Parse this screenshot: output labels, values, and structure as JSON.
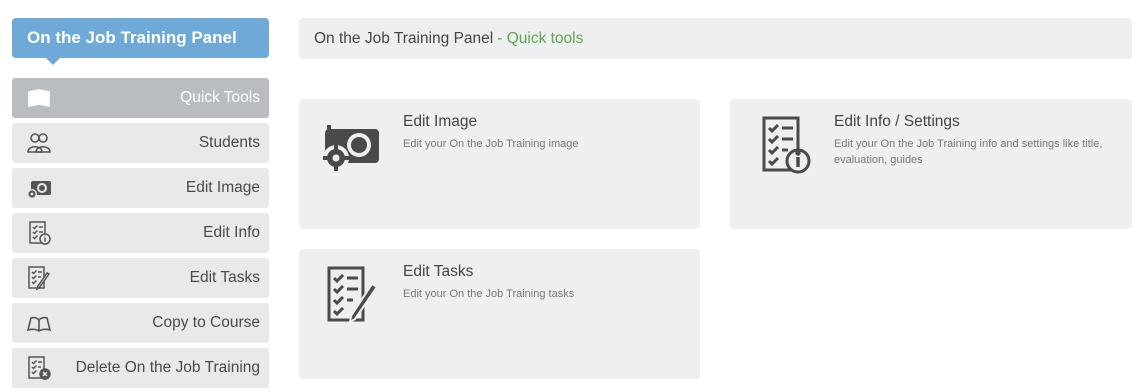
{
  "panel": {
    "title": "On the Job Training Panel"
  },
  "sidebar": {
    "items": [
      {
        "label": "Quick Tools",
        "icon": "quick-tools-icon",
        "active": true
      },
      {
        "label": "Students",
        "icon": "students-icon"
      },
      {
        "label": "Edit Image",
        "icon": "camera-icon"
      },
      {
        "label": "Edit Info",
        "icon": "checklist-info-icon"
      },
      {
        "label": "Edit Tasks",
        "icon": "checklist-pen-icon"
      },
      {
        "label": "Copy to Course",
        "icon": "book-icon"
      },
      {
        "label": "Delete On the Job Training",
        "icon": "checklist-delete-icon"
      }
    ]
  },
  "breadcrumb": {
    "main": "On the Job Training Panel",
    "sub": "- Quick tools"
  },
  "cards": [
    {
      "title": "Edit Image",
      "desc": "Edit your On the Job Training image",
      "icon": "camera-icon"
    },
    {
      "title": "Edit Info / Settings",
      "desc": "Edit your On the Job Training info and settings like title, evaluation, guides",
      "icon": "checklist-info-icon"
    },
    {
      "title": "Edit Tasks",
      "desc": "Edit your On the Job Training tasks",
      "icon": "checklist-pen-icon"
    }
  ],
  "colors": {
    "accent": "#6fa9d8",
    "active_item": "#b9bcc1",
    "subtitle_green": "#5aa84a"
  }
}
